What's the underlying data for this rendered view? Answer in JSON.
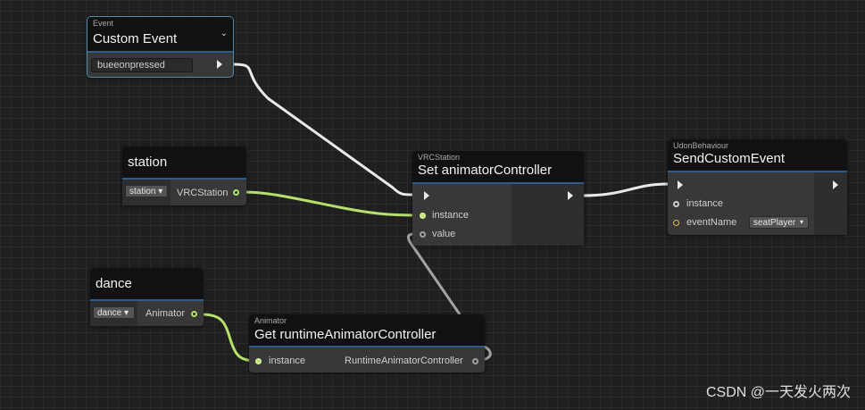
{
  "colors": {
    "flow": "#eaeaea",
    "object": "#b5e06b",
    "value": "#a3a3a3",
    "header_accent": "#2f5a8c",
    "selection": "#4d8ca8"
  },
  "nodes": {
    "custom_event": {
      "category": "Event",
      "title": "Custom Event",
      "field_value": "bueeonpressed"
    },
    "station": {
      "title": "station",
      "dropdown": "station",
      "output_label": "VRCStation"
    },
    "dance": {
      "title": "dance",
      "dropdown": "dance",
      "output_label": "Animator"
    },
    "set_controller": {
      "category": "VRCStation",
      "title": "Set animatorController",
      "inputs": [
        "instance",
        "value"
      ]
    },
    "get_controller": {
      "category": "Animator",
      "title": "Get runtimeAnimatorController",
      "input": "instance",
      "output": "RuntimeAnimatorController"
    },
    "send_event": {
      "category": "UdonBehaviour",
      "title": "SendCustomEvent",
      "inputs": [
        "instance",
        "eventName"
      ],
      "event_dropdown": "seatPlayer"
    }
  },
  "watermark": "CSDN @一天发火两次"
}
